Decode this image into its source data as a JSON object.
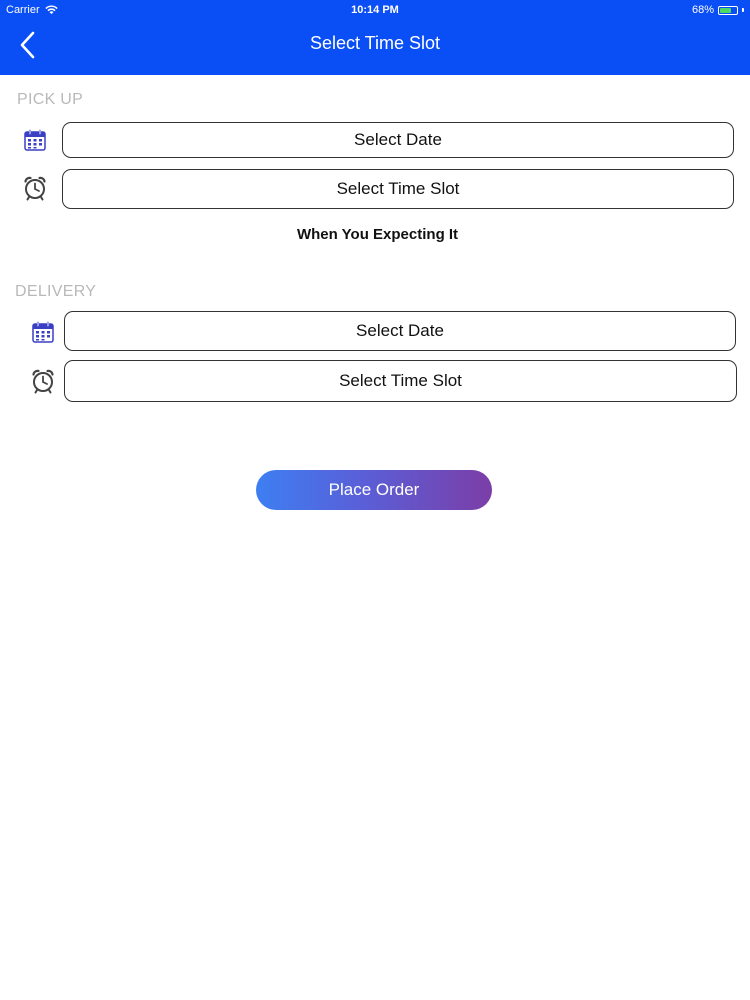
{
  "status_bar": {
    "carrier": "Carrier",
    "time": "10:14 PM",
    "battery": "68%",
    "battery_level": 0.68,
    "wifi_icon": "wifi-icon",
    "battery_icon": "battery-icon"
  },
  "nav": {
    "title": "Select Time Slot",
    "back_icon": "chevron-left-icon"
  },
  "pickup": {
    "label": "PICK UP",
    "date_placeholder": "Select Date",
    "time_placeholder": "Select Time Slot",
    "hint": "When You Expecting It"
  },
  "delivery": {
    "label": "DELIVERY",
    "date_placeholder": "Select Date",
    "time_placeholder": "Select Time Slot"
  },
  "actions": {
    "place_order": "Place Order"
  },
  "colors": {
    "nav_bg": "#0a4ef5",
    "section_label": "#b9b9b9",
    "button_gradient_start": "#3d7ff2",
    "button_gradient_end": "#7b3ea7",
    "calendar_icon": "#3a3fc4"
  }
}
